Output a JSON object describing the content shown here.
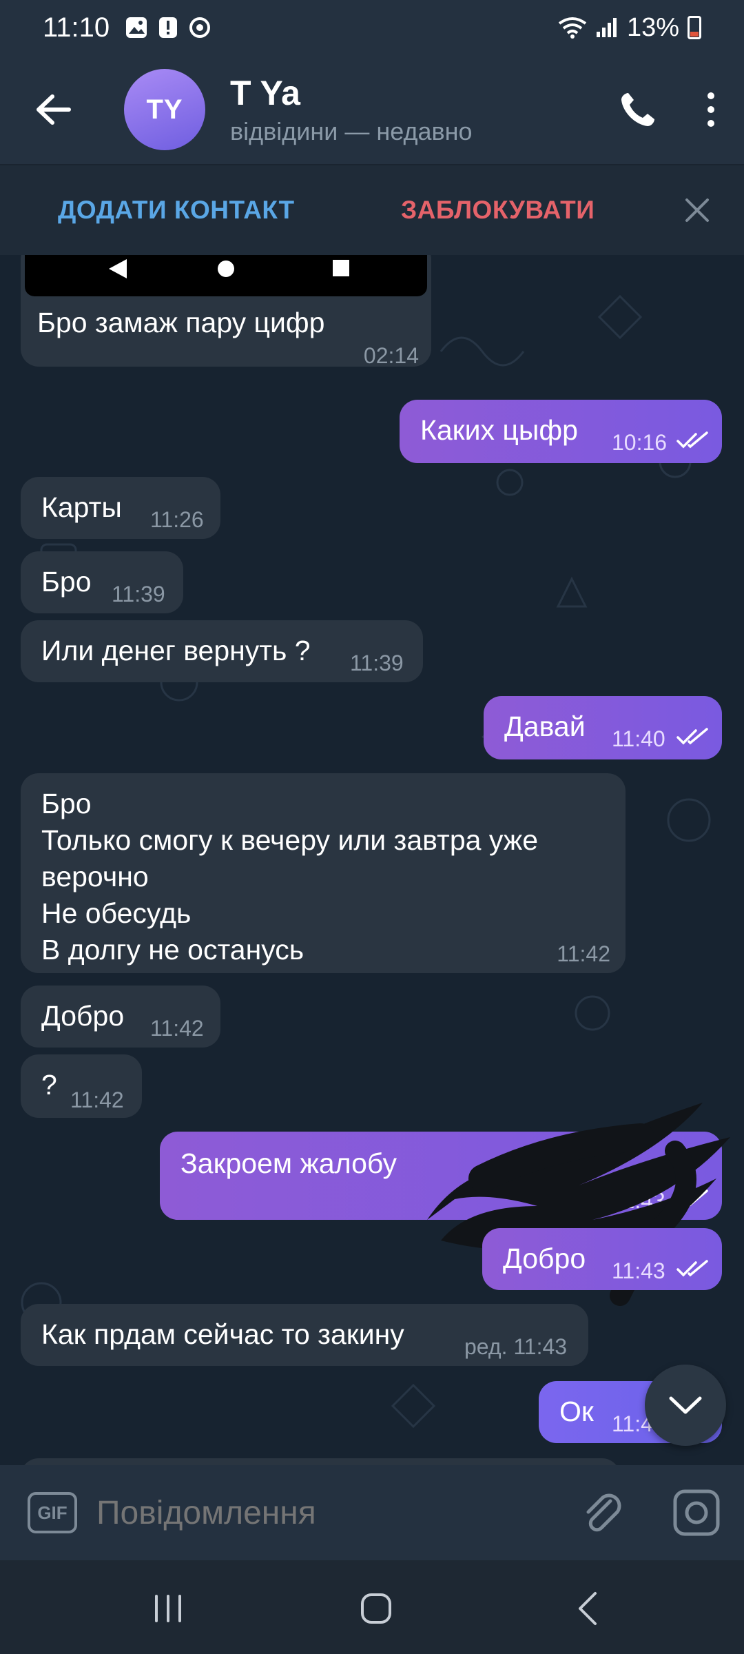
{
  "status_bar": {
    "time": "11:10",
    "battery": "13%",
    "battery_level": 0.13,
    "notification_icons": [
      "gallery-icon",
      "alert-icon",
      "sync-icon"
    ]
  },
  "header": {
    "avatar_initials": "TY",
    "contact_name": "T Ya",
    "last_seen": "відвідини — недавно"
  },
  "action_bar": {
    "add_contact": "ДОДАТИ КОНТАКТ",
    "block": "ЗАБЛОКУВАТИ"
  },
  "messages": [
    {
      "dir": "in",
      "text": "Бро замаж пару цифр",
      "time": "02:14"
    },
    {
      "dir": "out",
      "text": "Каких цыфр",
      "time": "10:16",
      "read": true
    },
    {
      "dir": "in",
      "text": "Карты",
      "time": "11:26"
    },
    {
      "dir": "in",
      "text": "Бро",
      "time": "11:39"
    },
    {
      "dir": "in",
      "text": "Или денег вернуть ?",
      "time": "11:39"
    },
    {
      "dir": "out",
      "text": "Давай",
      "time": "11:40",
      "read": true
    },
    {
      "dir": "in",
      "text": "Бро\nТолько смогу к вечеру или завтра уже\nверочно\nНе обесудь\nВ долгу не останусь",
      "time": "11:42"
    },
    {
      "dir": "in",
      "text": "Добро",
      "time": "11:42"
    },
    {
      "dir": "in",
      "text": "?",
      "time": "11:42"
    },
    {
      "dir": "out",
      "text": "Закроем жалобу",
      "time": "11:43",
      "read": true
    },
    {
      "dir": "out",
      "text": "Добро",
      "time": "11:43",
      "read": true
    },
    {
      "dir": "in",
      "text": "Как прдам сейчас то закину",
      "time": "ред. 11:43"
    },
    {
      "dir": "out",
      "text": "Ок",
      "time": "11:4",
      "read": true
    }
  ],
  "composer": {
    "gif_label": "GIF",
    "placeholder": "Повідомлення"
  },
  "colors": {
    "outgoing_bubble": "#8e5bd6",
    "incoming_bubble": "#2a3541",
    "accent_blue": "#5aa7e6",
    "danger_red": "#e5636a"
  }
}
